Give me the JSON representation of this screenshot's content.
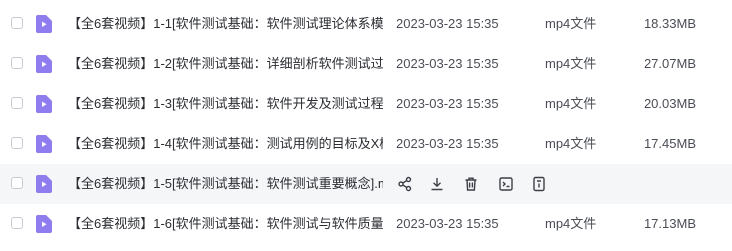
{
  "colors": {
    "video_icon": "#8f7df0",
    "hover_row_bg": "#f5f6f8",
    "icon_stroke": "#3c3f47"
  },
  "files": [
    {
      "name": "【全6套视频】1-1[软件测试基础：软件测试理论体系模...",
      "date": "2023-03-23 15:35",
      "type": "mp4文件",
      "size": "18.33MB",
      "icon": "video-file-icon"
    },
    {
      "name": "【全6套视频】1-2[软件测试基础：详细剖析软件测试过...",
      "date": "2023-03-23 15:35",
      "type": "mp4文件",
      "size": "27.07MB",
      "icon": "video-file-icon"
    },
    {
      "name": "【全6套视频】1-3[软件测试基础：软件开发及测试过程...",
      "date": "2023-03-23 15:35",
      "type": "mp4文件",
      "size": "20.03MB",
      "icon": "video-file-icon"
    },
    {
      "name": "【全6套视频】1-4[软件测试基础：测试用例的目标及X模...",
      "date": "2023-03-23 15:35",
      "type": "mp4文件",
      "size": "17.45MB",
      "icon": "video-file-icon"
    },
    {
      "name": "【全6套视频】1-5[软件测试基础：软件测试重要概念].m...",
      "hovered": true,
      "icon": "video-file-icon",
      "actions": [
        "share-icon",
        "download-icon",
        "delete-icon",
        "rename-icon",
        "more-icon"
      ]
    },
    {
      "name": "【全6套视频】1-6[软件测试基础：软件测试与软件质量...",
      "date": "2023-03-23 15:35",
      "type": "mp4文件",
      "size": "17.13MB",
      "icon": "video-file-icon"
    }
  ]
}
